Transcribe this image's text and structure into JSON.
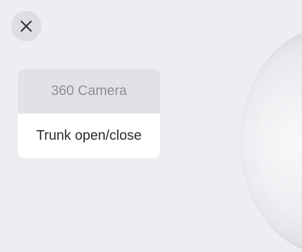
{
  "close_button": {
    "icon": "close-icon"
  },
  "menu": {
    "items": [
      {
        "label": "360 Camera",
        "state": "muted"
      },
      {
        "label": "Trunk open/close",
        "state": "active"
      }
    ]
  },
  "decor": {
    "camera_preview": "camera-lens-image"
  },
  "colors": {
    "background": "#ededf2",
    "close_button_bg": "#dddde2",
    "menu_muted_bg": "#e2e2e6",
    "menu_active_bg": "#ffffff",
    "text_muted": "#8f8f94",
    "text_primary": "#2b2b2e"
  }
}
